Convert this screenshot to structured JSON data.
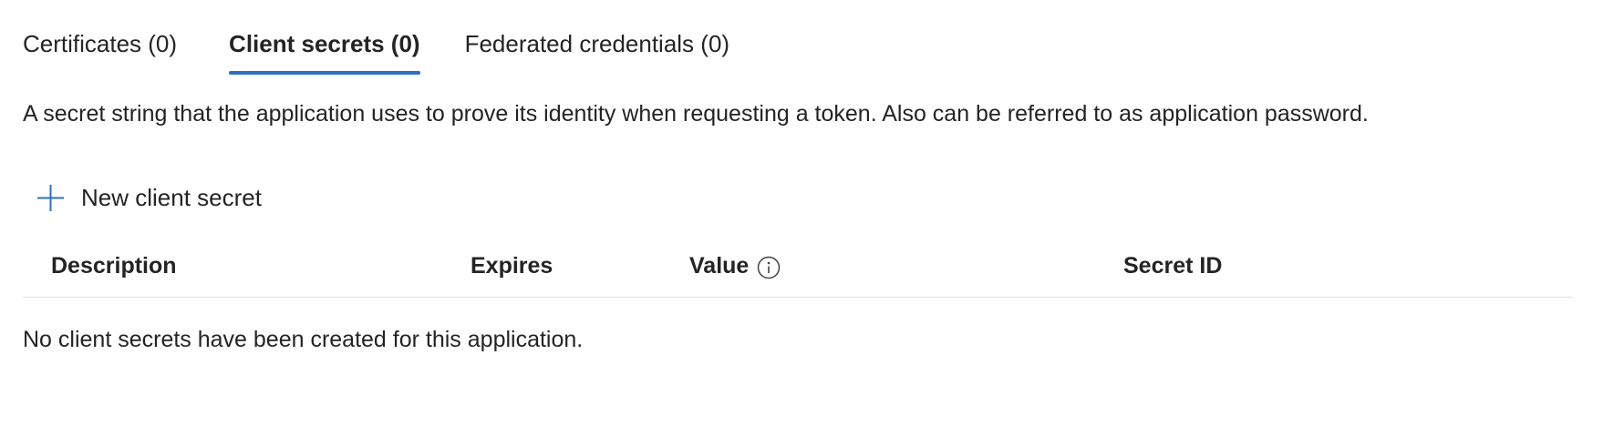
{
  "tabs": [
    {
      "label": "Certificates (0)",
      "selected": false
    },
    {
      "label": "Client secrets (0)",
      "selected": true
    },
    {
      "label": "Federated credentials (0)",
      "selected": false
    }
  ],
  "description": "A secret string that the application uses to prove its identity when requesting a token. Also can be referred to as application password.",
  "actions": {
    "new_secret_label": "New client secret",
    "new_secret_icon": "plus-icon"
  },
  "table": {
    "columns": {
      "description": "Description",
      "expires": "Expires",
      "value": "Value",
      "value_icon": "info-icon",
      "secret_id": "Secret ID"
    },
    "rows": [],
    "empty_message": "No client secrets have been created for this application."
  },
  "colors": {
    "accent": "#2f6fc2",
    "text": "#242424",
    "divider": "#e1e1e1"
  }
}
